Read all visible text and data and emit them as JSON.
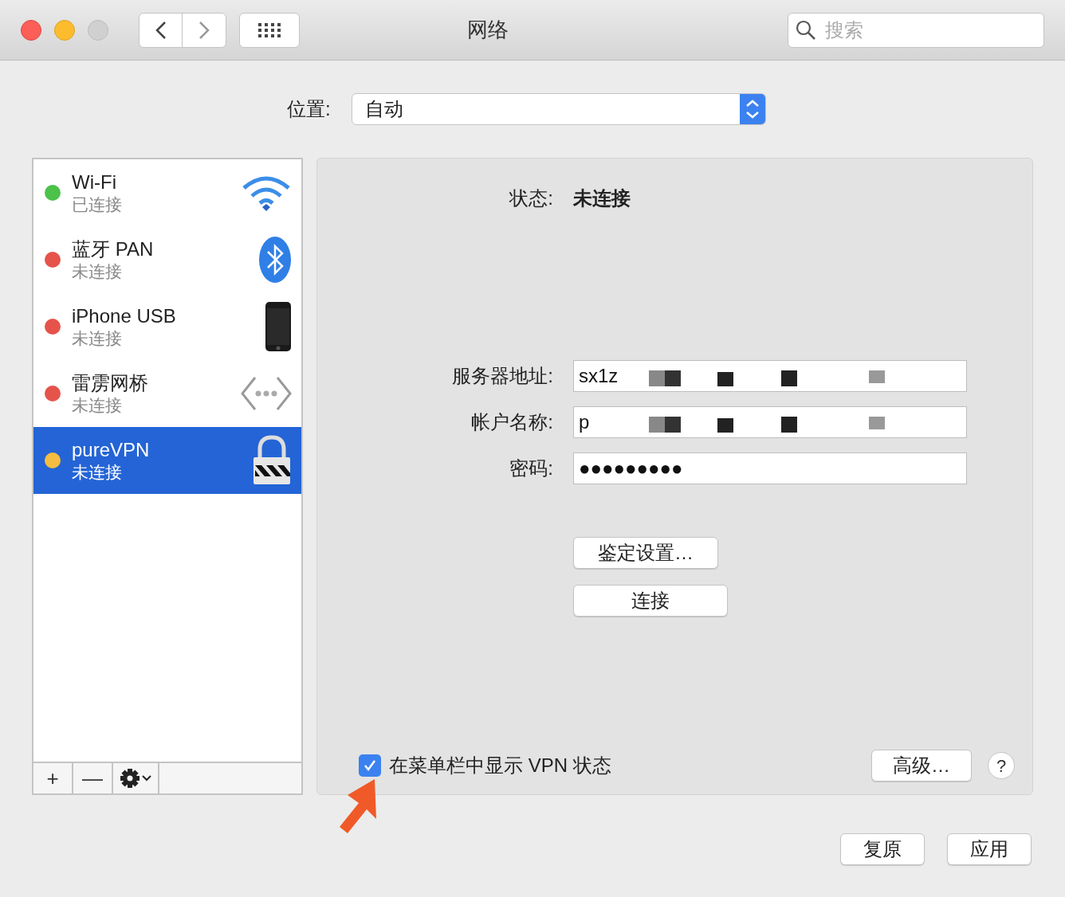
{
  "window": {
    "title": "网络",
    "search_placeholder": "搜索"
  },
  "location": {
    "label": "位置:",
    "value": "自动"
  },
  "services": [
    {
      "name": "Wi-Fi",
      "status": "已连接",
      "color": "#4cc24a",
      "kind": "wifi",
      "selected": false
    },
    {
      "name": "蓝牙 PAN",
      "status": "未连接",
      "color": "#e5534b",
      "kind": "bluetooth",
      "selected": false
    },
    {
      "name": "iPhone USB",
      "status": "未连接",
      "color": "#e5534b",
      "kind": "phone",
      "selected": false
    },
    {
      "name": "雷雳网桥",
      "status": "未连接",
      "color": "#e5534b",
      "kind": "bridge",
      "selected": false
    },
    {
      "name": "pureVPN",
      "status": "未连接",
      "color": "#f5bd41",
      "kind": "vpn",
      "selected": true
    }
  ],
  "sidebar_buttons": [
    "+",
    "—"
  ],
  "detail": {
    "status_label": "状态:",
    "status_value": "未连接",
    "fields": [
      {
        "label": "服务器地址:",
        "value": "sx1z"
      },
      {
        "label": "帐户名称:",
        "value": "p"
      },
      {
        "label": "密码:",
        "value": "●●●●●●●●●"
      }
    ],
    "buttons": [
      "鉴定设置…",
      "连接"
    ],
    "show_vpn_status": {
      "label": "在菜单栏中显示 VPN 状态",
      "checked": true
    },
    "advanced": "高级…",
    "help": "?"
  },
  "footer_buttons": [
    "复原",
    "应用"
  ]
}
